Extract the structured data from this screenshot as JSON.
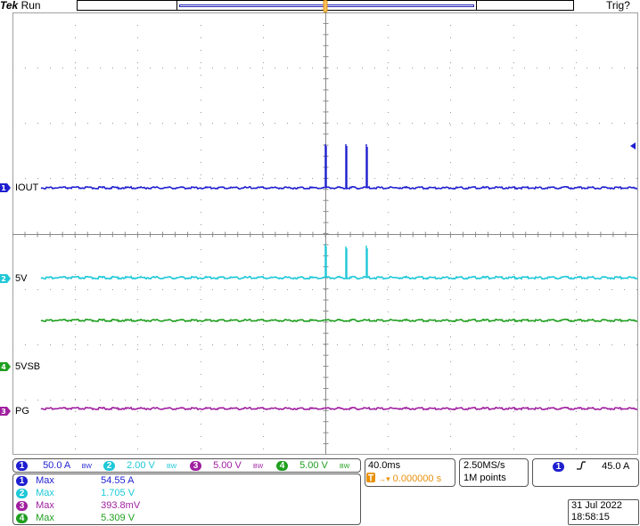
{
  "header": {
    "brand": "Tek",
    "run_state": "Run",
    "trigger_status": "Trig?"
  },
  "channels": [
    {
      "id": "1",
      "label": "IOUT",
      "color": "#1f1fd0"
    },
    {
      "id": "2",
      "label": "5V",
      "color": "#1ec8d8"
    },
    {
      "id": "3",
      "label": "PG",
      "color": "#a020a0"
    },
    {
      "id": "4",
      "label": "5VSB",
      "color": "#1f9f1f"
    }
  ],
  "vertical": [
    {
      "ch": "1",
      "scale": "50.0 A",
      "coupling": "BW"
    },
    {
      "ch": "2",
      "scale": "2.00 V",
      "coupling": "BW"
    },
    {
      "ch": "3",
      "scale": "5.00 V",
      "coupling": "BW"
    },
    {
      "ch": "4",
      "scale": "5.00 V",
      "coupling": "BW"
    }
  ],
  "horizontal": {
    "scale": "40.0ms",
    "trigger_position": "0.000000 s",
    "sample_rate": "2.50MS/s",
    "record_length": "1M points"
  },
  "trigger": {
    "source": "1",
    "slope": "rising",
    "level": "45.0 A"
  },
  "measurements": [
    {
      "ch": "1",
      "name": "Max",
      "value": "54.55 A"
    },
    {
      "ch": "2",
      "name": "Max",
      "value": "1.705 V"
    },
    {
      "ch": "3",
      "name": "Max",
      "value": "393.8mV"
    },
    {
      "ch": "4",
      "name": "Max",
      "value": "5.309 V"
    }
  ],
  "datetime": {
    "date": "31 Jul  2022",
    "time": "18:58:15"
  },
  "colors": {
    "ch1": "#1f1fd0",
    "ch2": "#1ec8d8",
    "ch3": "#a020a0",
    "ch4": "#1f9f1f",
    "trigger": "#e8900a"
  }
}
